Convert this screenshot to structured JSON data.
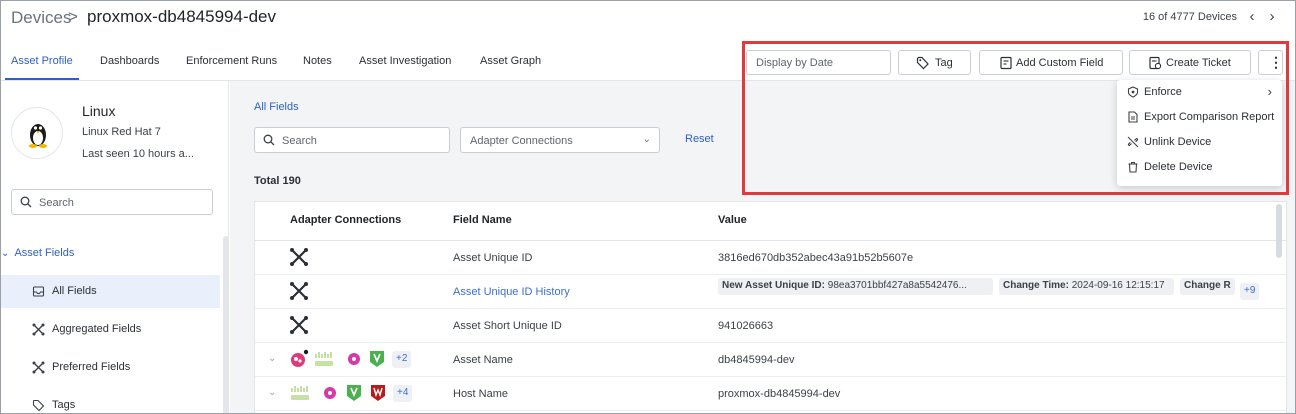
{
  "header": {
    "breadcrumb_root": "Devices",
    "breadcrumb_sep": ">",
    "device_name": "proxmox-db4845994-dev",
    "device_count": "16 of 4777 Devices",
    "prev_icon": "chevron-left-icon",
    "next_icon": "chevron-right-icon"
  },
  "tabs": [
    {
      "label": "Asset Profile",
      "active": true
    },
    {
      "label": "Dashboards"
    },
    {
      "label": "Enforcement Runs"
    },
    {
      "label": "Notes"
    },
    {
      "label": "Asset Investigation"
    },
    {
      "label": "Asset Graph"
    }
  ],
  "toolbar": {
    "display_by_date_placeholder": "Display by Date",
    "tag_label": "Tag",
    "add_custom_field_label": "Add Custom Field",
    "create_ticket_label": "Create Ticket",
    "more_label": "⋮"
  },
  "menu": {
    "items": [
      {
        "label": "Enforce",
        "icon": "enforce-icon",
        "has_submenu": true
      },
      {
        "label": "Export Comparison Report",
        "icon": "report-icon"
      },
      {
        "label": "Unlink Device",
        "icon": "unlink-icon"
      },
      {
        "label": "Delete Device",
        "icon": "trash-icon"
      }
    ]
  },
  "left": {
    "os_name": "Linux",
    "os_version": "Linux Red Hat 7",
    "last_seen": "Last seen 10 hours a...",
    "search_placeholder": "Search",
    "section_label": "Asset Fields",
    "items": [
      {
        "label": "All Fields",
        "active": true
      },
      {
        "label": "Aggregated Fields"
      },
      {
        "label": "Preferred Fields"
      },
      {
        "label": "Tags"
      }
    ]
  },
  "main": {
    "title": "All Fields",
    "search_placeholder": "Search",
    "adapter_filter_placeholder": "Adapter Connections",
    "reset_label": "Reset",
    "total": "Total 190",
    "columns": [
      "Adapter Connections",
      "Field Name",
      "Value"
    ],
    "rows": [
      {
        "field": "Asset Unique ID",
        "value": "3816ed670db352abec43a91b52b5607e"
      },
      {
        "field": "Asset Unique ID History",
        "chip1_key": "New Asset Unique ID:",
        "chip1_value": "98ea3701bbf427a8a5542476...",
        "chip2_key": "Change Time:",
        "chip2_value": "2024-09-16 12:15:17",
        "chip3_key": "Change R",
        "more": "+9"
      },
      {
        "field": "Asset Short Unique ID",
        "value": "941026663"
      },
      {
        "field": "Asset Name",
        "value": "db4845994-dev",
        "more_adapters": "+2"
      },
      {
        "field": "Host Name",
        "value": "proxmox-db4845994-dev",
        "more_adapters": "+4"
      }
    ]
  },
  "colors": {
    "accent": "#2f5fbf",
    "highlight": "#e0393e",
    "link": "#3a6fd0"
  }
}
